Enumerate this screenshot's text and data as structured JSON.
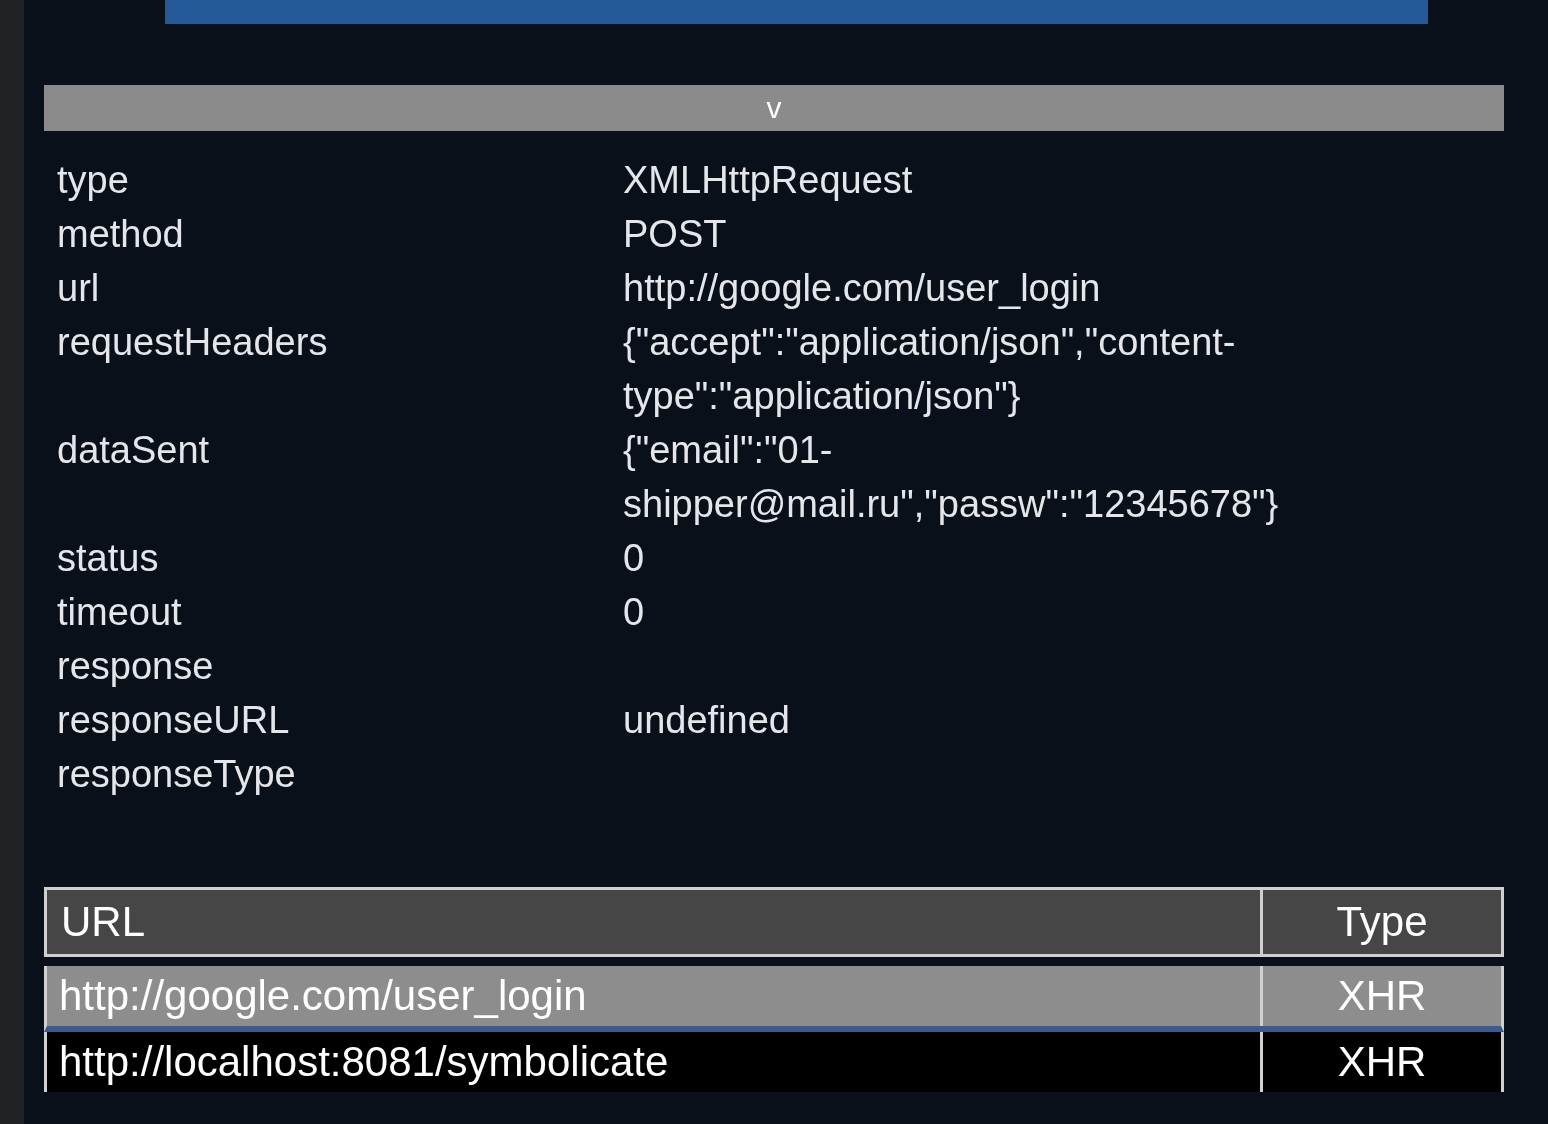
{
  "toggle": {
    "label": "v"
  },
  "details": [
    {
      "label": "type",
      "value": "XMLHttpRequest"
    },
    {
      "label": "method",
      "value": "POST"
    },
    {
      "label": "url",
      "value": "http://google.com/user_login"
    },
    {
      "label": "requestHeaders",
      "value": "{\"accept\":\"application/json\",\"content-type\":\"application/json\"}"
    },
    {
      "label": "dataSent",
      "value": "{\"email\":\"01-shipper@mail.ru\",\"passw\":\"12345678\"}"
    },
    {
      "label": "status",
      "value": "0"
    },
    {
      "label": "timeout",
      "value": "0"
    },
    {
      "label": "response"
    },
    {
      "label": "responseURL",
      "value": "undefined"
    },
    {
      "label": "responseType"
    }
  ],
  "table": {
    "columns": [
      "URL",
      "Type"
    ],
    "rows": [
      {
        "url": "http://google.com/user_login",
        "type": "XHR",
        "selected": true
      },
      {
        "url": "http://localhost:8081/symbolicate",
        "type": "XHR",
        "selected": false
      }
    ]
  }
}
